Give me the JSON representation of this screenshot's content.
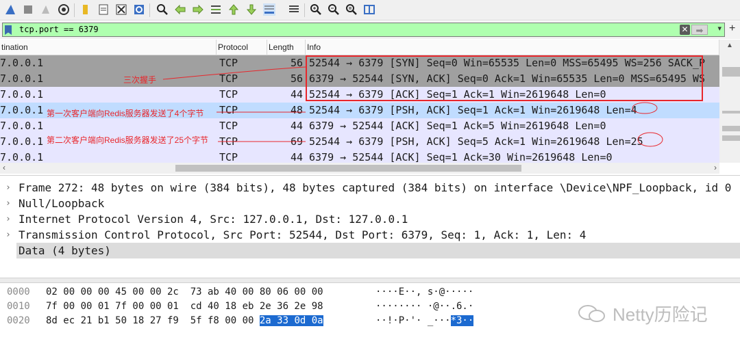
{
  "toolbar": {
    "icons": [
      "shark-fin-start-icon",
      "stop-icon",
      "restart-icon",
      "options-gear-icon",
      "open-folder-icon",
      "save-file-icon",
      "close-file-icon",
      "reload-icon",
      "find-icon",
      "go-back-icon",
      "go-forward-icon",
      "go-to-packet-icon",
      "first-packet-icon",
      "last-packet-icon",
      "autoscroll-icon",
      "colorize-icon",
      "zoom-in-icon",
      "zoom-out-icon",
      "zoom-normal-icon",
      "resize-columns-icon"
    ]
  },
  "filter": {
    "value": "tcp.port == 6379",
    "status_color": "#afffaf"
  },
  "packet_list": {
    "columns": [
      "tination",
      "Protocol",
      "Length",
      "Info"
    ],
    "rows": [
      {
        "dst": "7.0.0.1",
        "proto": "TCP",
        "len": "56",
        "info": "52544 → 6379 [SYN] Seq=0 Win=65535 Len=0 MSS=65495 WS=256 SACK_P",
        "bg": "#a0a0a0"
      },
      {
        "dst": "7.0.0.1",
        "proto": "TCP",
        "len": "56",
        "info": "6379 → 52544 [SYN, ACK] Seq=0 Ack=1 Win=65535 Len=0 MSS=65495 WS",
        "bg": "#a0a0a0"
      },
      {
        "dst": "7.0.0.1",
        "proto": "TCP",
        "len": "44",
        "info": "52544 → 6379 [ACK] Seq=1 Ack=1 Win=2619648 Len=0",
        "bg": "#e7e6ff"
      },
      {
        "dst": "7.0.0.1",
        "proto": "TCP",
        "len": "48",
        "info": "52544 → 6379 [PSH, ACK] Seq=1 Ack=1 Win=2619648 Len=4",
        "bg": "#c0dcff"
      },
      {
        "dst": "7.0.0.1",
        "proto": "TCP",
        "len": "44",
        "info": "6379 → 52544 [ACK] Seq=1 Ack=5 Win=2619648 Len=0",
        "bg": "#e7e6ff"
      },
      {
        "dst": "7.0.0.1",
        "proto": "TCP",
        "len": "69",
        "info": "52544 → 6379 [PSH, ACK] Seq=5 Ack=1 Win=2619648 Len=25",
        "bg": "#e7e6ff"
      },
      {
        "dst": "7.0.0.1",
        "proto": "TCP",
        "len": "44",
        "info": "6379 → 52544 [ACK] Seq=1 Ack=30 Win=2619648 Len=0",
        "bg": "#e7e6ff"
      }
    ],
    "annotations": {
      "handshake": "三次握手",
      "first_send": "第一次客户端向Redis服务器发送了4个字节",
      "second_send": "第二次客户端向Redis服务器发送了25个字节"
    },
    "annotation_color": "#e8262b"
  },
  "details": {
    "rows": [
      "Frame 272: 48 bytes on wire (384 bits), 48 bytes captured (384 bits) on interface \\Device\\NPF_Loopback, id 0",
      "Null/Loopback",
      "Internet Protocol Version 4, Src: 127.0.0.1, Dst: 127.0.0.1",
      "Transmission Control Protocol, Src Port: 52544, Dst Port: 6379, Seq: 1, Ack: 1, Len: 4",
      "Data (4 bytes)"
    ]
  },
  "hex": {
    "rows": [
      {
        "offset": "0000",
        "bytes": "02 00 00 00 45 00 00 2c  73 ab 40 00 80 06 00 00",
        "bytes_hl": "",
        "ascii": "····E··, s·@·····",
        "ascii_hl": ""
      },
      {
        "offset": "0010",
        "bytes": "7f 00 00 01 7f 00 00 01  cd 40 18 eb 2e 36 2e 98",
        "bytes_hl": "",
        "ascii": "········ ·@··.6.·",
        "ascii_hl": ""
      },
      {
        "offset": "0020",
        "bytes": "8d ec 21 b1 50 18 27 f9  5f f8 00 00 ",
        "bytes_hl": "2a 33 0d 0a",
        "ascii": "··!·P·'· _···",
        "ascii_hl": "*3··"
      }
    ],
    "highlight_color": "#1c6ad0"
  },
  "watermark": "Netty历险记"
}
